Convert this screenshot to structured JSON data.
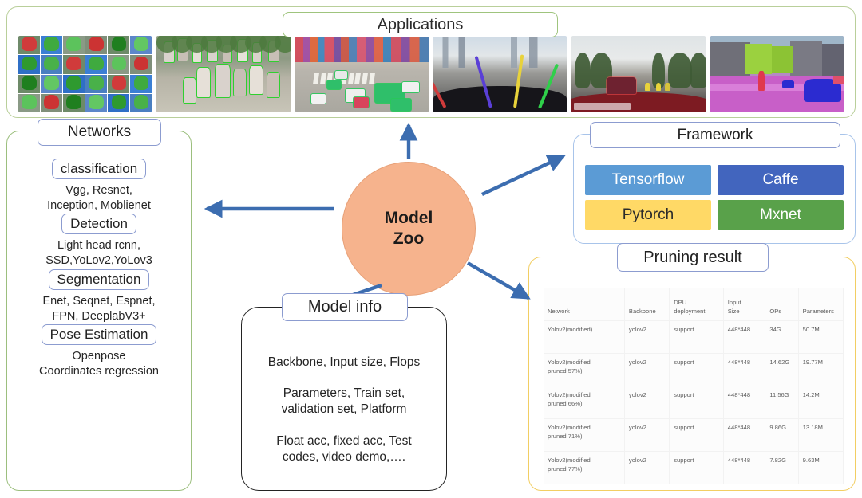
{
  "applications": {
    "title": "Applications",
    "thumbnails": [
      {
        "name": "face-attribute-grid",
        "caption": "face attribute grid"
      },
      {
        "name": "pedestrian-detection",
        "caption": "pedestrian detection"
      },
      {
        "name": "traffic-intersection-detection",
        "caption": "traffic intersection detection"
      },
      {
        "name": "lane-detection",
        "caption": "lane detection"
      },
      {
        "name": "dashcam-driving-scene",
        "caption": "dashcam driving scene"
      },
      {
        "name": "semantic-segmentation",
        "caption": "semantic segmentation"
      }
    ]
  },
  "networks": {
    "title": "Networks",
    "sections": [
      {
        "label": "classification",
        "items": "Vgg, Resnet,\nInception, Moblienet"
      },
      {
        "label": "Detection",
        "items": "Light head rcnn,\nSSD,YoLov2,YoLov3"
      },
      {
        "label": "Segmentation",
        "items": "Enet, Seqnet, Espnet,\nFPN, DeeplabV3+"
      },
      {
        "label": "Pose Estimation",
        "items": "Openpose\nCoordinates regression"
      }
    ]
  },
  "center": {
    "line1": "Model",
    "line2": "Zoo",
    "color": "#f6b38d"
  },
  "framework": {
    "title": "Framework",
    "items": [
      {
        "label": "Tensorflow",
        "bg": "#5b9bd5",
        "fg": "#ffffff"
      },
      {
        "label": "Caffe",
        "bg": "#4265be",
        "fg": "#ffffff"
      },
      {
        "label": "Pytorch",
        "bg": "#ffd966",
        "fg": "#2b2b2b"
      },
      {
        "label": "Mxnet",
        "bg": "#59a14a",
        "fg": "#ffffff"
      }
    ]
  },
  "model_info": {
    "title": "Model info",
    "lines": [
      "Backbone, Input size, Flops",
      "Parameters, Train set,\nvalidation set, Platform",
      "Float acc, fixed acc, Test\ncodes, video demo,…."
    ]
  },
  "pruning_result": {
    "title": "Pruning result",
    "columns": [
      "Network",
      "Backbone",
      "DPU\ndeployment",
      "Input\nSize",
      "OPs",
      "Parameters"
    ],
    "rows": [
      [
        "Yolov2(modified)",
        "yolov2",
        "support",
        "448*448",
        "34G",
        "50.7M"
      ],
      [
        "Yolov2(modified\npruned 57%)",
        "yolov2",
        "support",
        "448*448",
        "14.62G",
        "19.77M"
      ],
      [
        "Yolov2(modified\npruned 66%)",
        "yolov2",
        "support",
        "448*448",
        "11.56G",
        "14.2M"
      ],
      [
        "Yolov2(modified\npruned 71%)",
        "yolov2",
        "support",
        "448*448",
        "9.86G",
        "13.18M"
      ],
      [
        "Yolov2(modified\npruned 77%)",
        "yolov2",
        "support",
        "448*448",
        "7.82G",
        "9.63M"
      ]
    ]
  },
  "arrows": {
    "color": "#3c6db0",
    "items": [
      {
        "name": "arrow-zoo-to-applications",
        "direction": "up"
      },
      {
        "name": "arrow-zoo-to-networks",
        "direction": "left"
      },
      {
        "name": "arrow-zoo-to-framework",
        "direction": "up-right"
      },
      {
        "name": "arrow-zoo-to-model-info",
        "direction": "down-left"
      },
      {
        "name": "arrow-zoo-to-pruning-result",
        "direction": "down-right"
      }
    ]
  }
}
